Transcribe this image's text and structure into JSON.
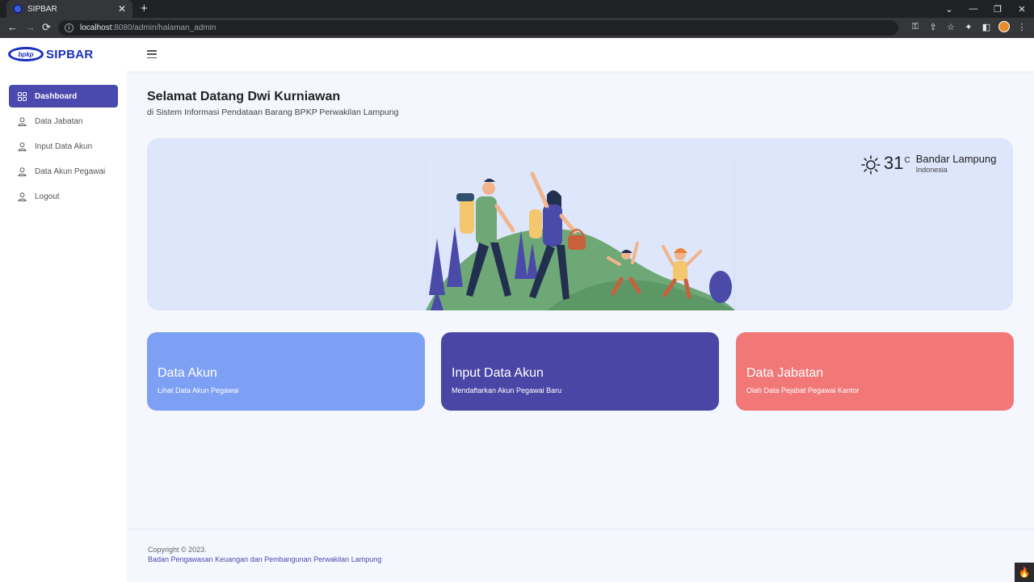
{
  "browser": {
    "tab_title": "SIPBAR",
    "close_glyph": "✕",
    "new_tab_glyph": "+",
    "url_host": "localhost",
    "url_path": ":8080/admin/halaman_admin",
    "back_glyph": "←",
    "forward_glyph": "→",
    "reload_glyph": "⟳",
    "window_controls": [
      "⌄",
      "—",
      "❐",
      "✕"
    ],
    "toolbar_icons": [
      "⚿",
      "⇪",
      "☆",
      "✦",
      "◧",
      "⋮"
    ]
  },
  "header": {
    "logo_badge": "bpkp",
    "brand": "SIPBAR"
  },
  "sidebar": {
    "items": [
      {
        "label": "Dashboard",
        "icon": "grid-icon",
        "active": true
      },
      {
        "label": "Data Jabatan",
        "icon": "user-icon",
        "active": false
      },
      {
        "label": "Input Data Akun",
        "icon": "user-icon",
        "active": false
      },
      {
        "label": "Data Akun Pegawai",
        "icon": "user-icon",
        "active": false
      },
      {
        "label": "Logout",
        "icon": "user-icon",
        "active": false
      }
    ]
  },
  "main": {
    "title": "Selamat Datang Dwi Kurniawan",
    "subtitle": "di Sistem Informasi Pendataan Barang BPKP Perwakilan Lampung",
    "weather": {
      "temp": "31",
      "unit": "C",
      "city": "Bandar Lampung",
      "country": "Indonesia"
    },
    "cards": [
      {
        "title": "Data Akun",
        "subtitle": "Lihat Data Akun Pegawai",
        "color": "#7da0f5"
      },
      {
        "title": "Input Data Akun",
        "subtitle": "Mendaftarkan Akun Pegawai Baru",
        "color": "#4a46a5"
      },
      {
        "title": "Data Jabatan",
        "subtitle": "Olah Data Pejabat Pegawai Kantor",
        "color": "#f27878"
      }
    ]
  },
  "footer": {
    "copyright": "Copyright © 2023.",
    "org": "Badan Pengawasan Keuangan dan Pembangunan Perwakilan Lampung"
  },
  "colors": {
    "accent": "#4a49ad",
    "brand": "#1a2fbf",
    "hero_bg": "#dde6fb"
  }
}
